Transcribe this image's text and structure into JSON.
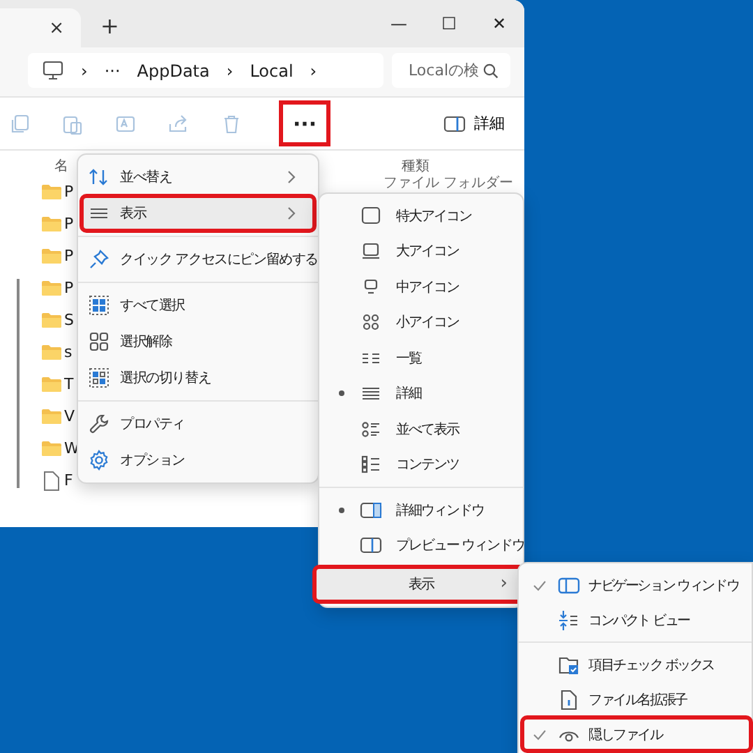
{
  "window": {
    "tab_close": "×",
    "new_tab": "+",
    "controls": [
      "—",
      "☐",
      "✕"
    ]
  },
  "address_bar": {
    "segments": [
      "›",
      "···",
      "AppData",
      "›",
      "Local",
      "›"
    ]
  },
  "search": {
    "placeholder": "Localの検"
  },
  "toolbar": {
    "more": "···",
    "more_highlighted": true,
    "details": "詳細"
  },
  "file_list": {
    "columns": [
      "名",
      "種類"
    ],
    "rows": [
      {
        "kind": "folder",
        "name": "P",
        "type": "ファイル フォルダー"
      },
      {
        "kind": "folder",
        "name": "P"
      },
      {
        "kind": "folder",
        "name": "P"
      },
      {
        "kind": "folder",
        "name": "P"
      },
      {
        "kind": "folder",
        "name": "S"
      },
      {
        "kind": "folder",
        "name": "s"
      },
      {
        "kind": "folder",
        "name": "T"
      },
      {
        "kind": "folder",
        "name": "V"
      },
      {
        "kind": "folder",
        "name": "W"
      },
      {
        "kind": "file",
        "name": "F"
      }
    ]
  },
  "menu": {
    "sections": [
      [
        {
          "label": "並べ替え",
          "submenu": true,
          "highlighted": false
        },
        {
          "label": "表示",
          "submenu": true,
          "highlighted": true
        }
      ],
      [
        {
          "label": "クイック アクセスにピン留めする",
          "submenu": false,
          "highlighted": false
        }
      ],
      [
        {
          "label": "すべて選択",
          "submenu": false,
          "highlighted": false
        },
        {
          "label": "選択解除",
          "submenu": false,
          "highlighted": false
        },
        {
          "label": "選択の切り替え",
          "submenu": false,
          "highlighted": false
        }
      ],
      [
        {
          "label": "プロパティ",
          "submenu": false,
          "highlighted": false
        },
        {
          "label": "オプション",
          "submenu": false,
          "highlighted": false
        }
      ]
    ]
  },
  "view_menu": {
    "sections": [
      [
        {
          "label": "特大アイコン",
          "selected": false
        },
        {
          "label": "大アイコン",
          "selected": false
        },
        {
          "label": "中アイコン",
          "selected": false
        },
        {
          "label": "小アイコン",
          "selected": false
        },
        {
          "label": "一覧",
          "selected": false
        },
        {
          "label": "詳細",
          "selected": true
        },
        {
          "label": "並べて表示",
          "selected": false
        },
        {
          "label": "コンテンツ",
          "selected": false
        }
      ],
      [
        {
          "label": "詳細ウィンドウ",
          "selected": true
        },
        {
          "label": "プレビュー ウィンドウ",
          "selected": false
        }
      ]
    ],
    "show": {
      "label": "表示",
      "arrow": "›",
      "highlighted": true
    }
  },
  "show_menu": {
    "sections": [
      [
        {
          "label": "ナビゲーション ウィンドウ",
          "checked": true,
          "highlighted": false
        },
        {
          "label": "コンパクト ビュー",
          "checked": false,
          "highlighted": false
        }
      ],
      [
        {
          "label": "項目チェック ボックス",
          "checked": false,
          "highlighted": false
        },
        {
          "label": "ファイル名拡張子",
          "checked": false,
          "highlighted": false
        },
        {
          "label": "隠しファイル",
          "checked": true,
          "highlighted": true
        }
      ]
    ]
  }
}
